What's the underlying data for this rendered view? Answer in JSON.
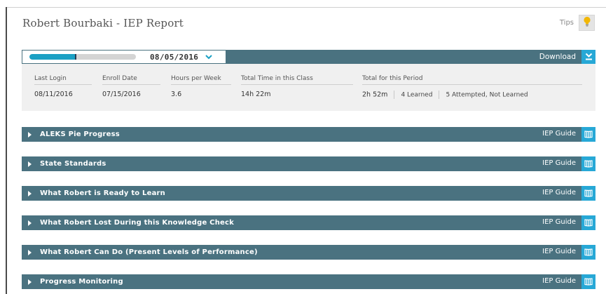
{
  "header": {
    "title": "Robert Bourbaki - IEP Report",
    "tips_label": "Tips",
    "tips_icon": "lightbulb-icon",
    "tips_icon_color": "#f2b705"
  },
  "report_bar": {
    "progress_fraction": 0.44,
    "progress_marker_fraction": 0.425,
    "date": "08/05/2016",
    "download_label": "Download",
    "accent_color": "#27a8d6",
    "bar_color": "#4a7280"
  },
  "stats": {
    "last_login": {
      "label": "Last Login",
      "value": "08/11/2016"
    },
    "enroll_date": {
      "label": "Enroll Date",
      "value": "07/15/2016"
    },
    "hours_per_week": {
      "label": "Hours per Week",
      "value": "3.6"
    },
    "total_time": {
      "label": "Total Time in this Class",
      "value": "14h 22m"
    },
    "period": {
      "label": "Total for this Period",
      "time": "2h 52m",
      "learned": "4 Learned",
      "attempted": "5 Attempted, Not Learned"
    }
  },
  "sections": [
    {
      "title": "ALEKS Pie Progress",
      "guide": "IEP Guide"
    },
    {
      "title": "State Standards",
      "guide": "IEP Guide"
    },
    {
      "title": "What Robert is Ready to Learn",
      "guide": "IEP Guide"
    },
    {
      "title": "What Robert Lost During this Knowledge Check",
      "guide": "IEP Guide"
    },
    {
      "title": "What Robert Can Do (Present Levels of Performance)",
      "guide": "IEP Guide"
    },
    {
      "title": "Progress Monitoring",
      "guide": "IEP Guide"
    }
  ]
}
